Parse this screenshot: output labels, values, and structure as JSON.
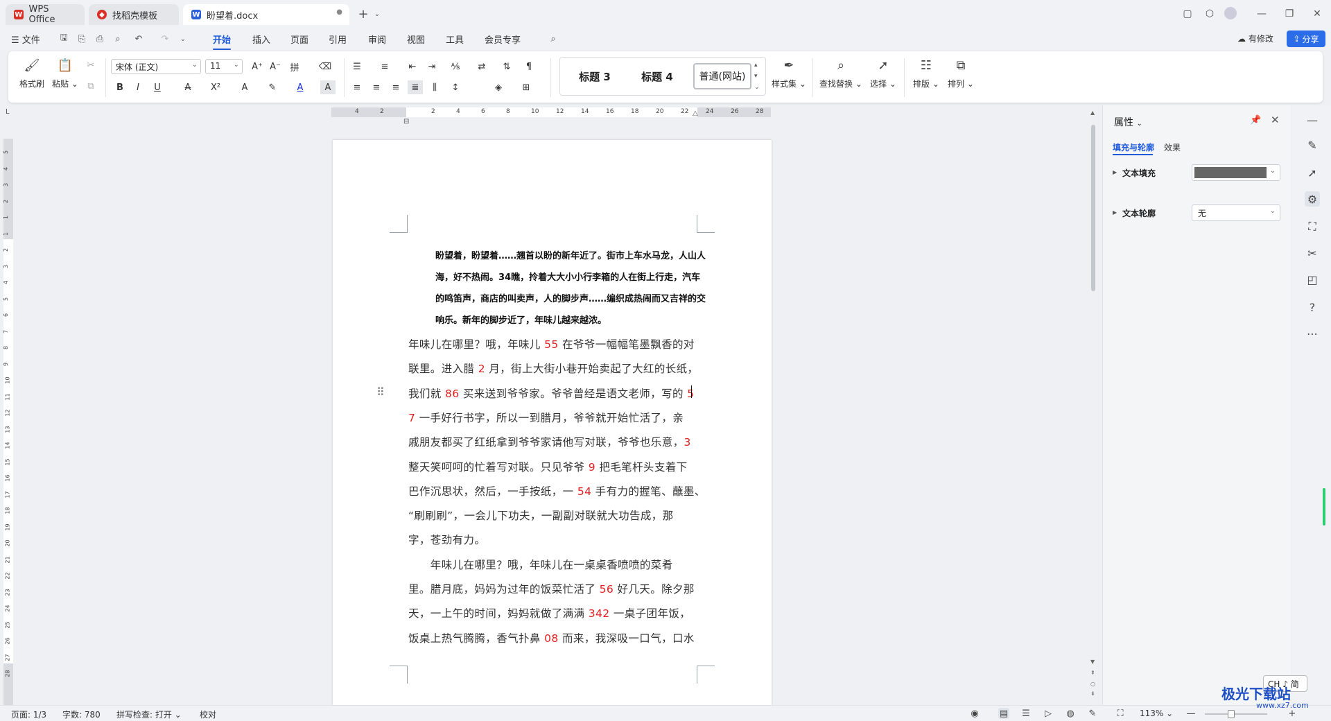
{
  "titlebar": {
    "tabs": [
      {
        "label": "WPS Office",
        "icon": "wps-logo-icon",
        "color": "#d93025"
      },
      {
        "label": "找稻壳模板",
        "icon": "docer-icon",
        "color": "#d93025"
      },
      {
        "label": "盼望着.docx",
        "icon": "word-doc-icon",
        "color": "#2b5fd9"
      }
    ],
    "new_tab": "+"
  },
  "menubar": {
    "file": "文件",
    "items": [
      "开始",
      "插入",
      "页面",
      "引用",
      "审阅",
      "视图",
      "工具",
      "会员专享"
    ],
    "active": "开始",
    "modified": "有修改",
    "share": "分享"
  },
  "ribbon": {
    "format_painter": "格式刷",
    "paste": "粘贴",
    "font_name": "宋体 (正文)",
    "font_size": "11",
    "styles": [
      "标题 3",
      "标题 4",
      "普通(网站)"
    ],
    "style_set": "样式集",
    "find_replace": "查找替换",
    "select": "选择",
    "layout": "排版",
    "arrange": "排列"
  },
  "ruler": {
    "h_labels": [
      "4",
      "2",
      "2",
      "4",
      "6",
      "8",
      "10",
      "12",
      "14",
      "16",
      "18",
      "20",
      "22",
      "24",
      "26",
      "28"
    ],
    "v_labels": [
      "5",
      "4",
      "3",
      "2",
      "1",
      "1",
      "2",
      "3",
      "4",
      "5",
      "6",
      "7",
      "8",
      "9",
      "10",
      "11",
      "12",
      "13",
      "14",
      "15",
      "16",
      "17",
      "18",
      "19",
      "20",
      "21",
      "22",
      "23",
      "24",
      "25",
      "26",
      "27",
      "28"
    ]
  },
  "document": {
    "bold_paragraph": [
      "盼望着，盼望着……翘首以盼的新年近了。街市上车水马龙，人山人",
      "海，好不热闹。34瞧，拎着大大小小行李箱的人在街上行走，汽车",
      "的鸣笛声，商店的叫卖声，人的脚步声……编织成热闹而又吉祥的交",
      "响乐。新年的脚步近了，年味儿越来越浓。"
    ],
    "lines": [
      [
        {
          "t": "年味儿在哪里？哦，年味儿 "
        },
        {
          "t": "55",
          "red": true
        },
        {
          "t": " 在爷爷一幅幅笔墨飘香的对"
        }
      ],
      [
        {
          "t": "联里。进入腊 "
        },
        {
          "t": "2",
          "red": true
        },
        {
          "t": " 月，街上大街小巷开始卖起了大红的长纸，"
        }
      ],
      [
        {
          "t": "我们就 "
        },
        {
          "t": "86",
          "red": true
        },
        {
          "t": " 买来送到爷爷家。爷爷曾经是语文老师，写的 "
        },
        {
          "t": "5",
          "red": true
        }
      ],
      [
        {
          "t": "7",
          "red": true
        },
        {
          "t": " 一手好行书字，所以一到腊月，爷爷就开始忙活了，亲"
        }
      ],
      [
        {
          "t": "戚朋友都买了红纸拿到爷爷家请他写对联，爷爷也乐意，"
        },
        {
          "t": "3",
          "red": true
        }
      ],
      [
        {
          "t": "整天笑呵呵的忙着写对联。只见爷爷 "
        },
        {
          "t": "9",
          "red": true
        },
        {
          "t": " 把毛笔杆头支着下"
        }
      ],
      [
        {
          "t": "巴作沉思状，然后，一手按纸，一 "
        },
        {
          "t": "54",
          "red": true
        },
        {
          "t": " 手有力的握笔、蘸墨、"
        }
      ],
      [
        {
          "t": "“刷刷刷”，一会儿下功夫，一副副对联就大功告成，那"
        }
      ],
      [
        {
          "t": "字，苍劲有力。"
        }
      ],
      [
        {
          "t": "　　年味儿在哪里？哦，年味儿在一桌桌香喷喷的菜肴"
        }
      ],
      [
        {
          "t": "里。腊月底，妈妈为过年的饭菜忙活了 "
        },
        {
          "t": "56",
          "red": true
        },
        {
          "t": " 好几天。除夕那"
        }
      ],
      [
        {
          "t": "天，一上午的时间，妈妈就做了满满 "
        },
        {
          "t": "342",
          "red": true
        },
        {
          "t": " 一桌子团年饭，"
        }
      ],
      [
        {
          "t": "饭桌上热气腾腾，香气扑鼻 "
        },
        {
          "t": "08",
          "red": true
        },
        {
          "t": " 而来，我深吸一口气，口水"
        }
      ]
    ]
  },
  "panel": {
    "title": "属性",
    "tabs": [
      "填充与轮廓",
      "效果"
    ],
    "active_tab": "填充与轮廓",
    "text_fill_label": "文本填充",
    "text_fill_color": "#666666",
    "text_outline_label": "文本轮廓",
    "text_outline_value": "无"
  },
  "statusbar": {
    "page": "页面: 1/3",
    "words": "字数: 780",
    "spell": "拼写检查: 打开",
    "proof": "校对",
    "zoom": "113%"
  },
  "ime": {
    "label": "CH ♪ 简"
  },
  "watermark": {
    "title": "极光下载站",
    "sub": "www.xz7.com"
  },
  "colors": {
    "accent": "#1f5bd8",
    "red_number": "#e02020",
    "share_bg": "#2b6de8"
  }
}
